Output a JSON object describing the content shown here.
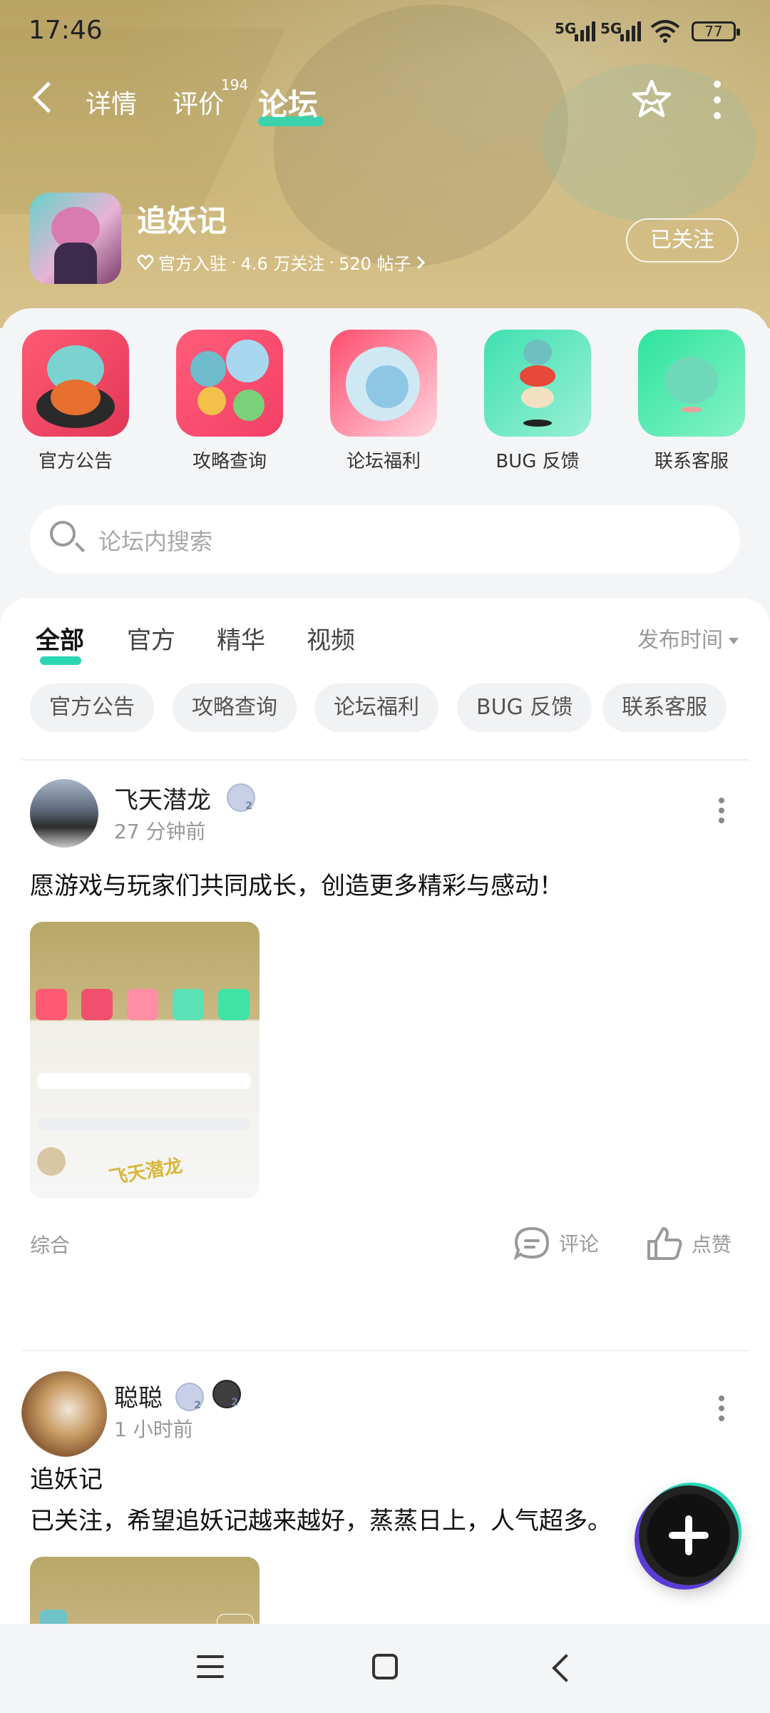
{
  "status_bar": {
    "time": "17:46",
    "signal1": "5G",
    "signal2": "5G",
    "battery": "77"
  },
  "nav": {
    "tabs": [
      {
        "label": "详情"
      },
      {
        "label": "评价",
        "badge": "194"
      },
      {
        "label": "论坛",
        "active": true
      }
    ]
  },
  "forum": {
    "name": "追妖记",
    "verified": "官方入驻",
    "followers": "4.6 万关注",
    "posts": "520 帖子",
    "follow_label": "已关注"
  },
  "categories": [
    {
      "label": "官方公告"
    },
    {
      "label": "攻略查询"
    },
    {
      "label": "论坛福利"
    },
    {
      "label": "BUG 反馈"
    },
    {
      "label": "联系客服"
    }
  ],
  "search": {
    "placeholder": "论坛内搜索"
  },
  "feed_tabs": [
    {
      "label": "全部",
      "active": true
    },
    {
      "label": "官方"
    },
    {
      "label": "精华"
    },
    {
      "label": "视频"
    }
  ],
  "sort_label": "发布时间",
  "chips": [
    "官方公告",
    "攻略查询",
    "论坛福利",
    "BUG 反馈",
    "联系客服"
  ],
  "posts": [
    {
      "author": "飞天潜龙",
      "time": "27 分钟前",
      "text": "愿游戏与玩家们共同成长，创造更多精彩与感动！",
      "tag": "综合",
      "comment_label": "评论",
      "like_label": "点赞",
      "thumb_watermark": "飞天潜龙"
    },
    {
      "author": "聪聪",
      "time": "1 小时前",
      "title": "追妖记",
      "text": "已关注，希望追妖记越来越好，蒸蒸日上，人气超多。"
    }
  ],
  "colors": {
    "accent": "#2bd6b4",
    "hero": "#c7b173"
  }
}
